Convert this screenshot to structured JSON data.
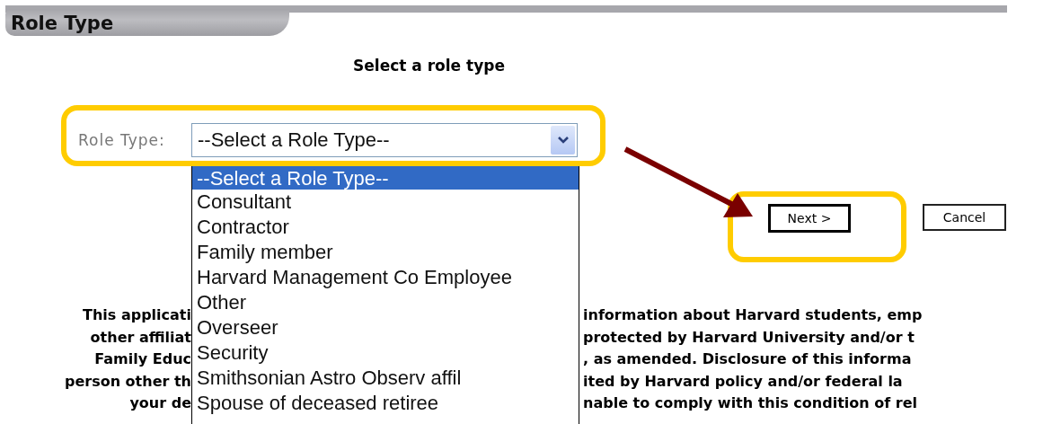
{
  "header": {
    "title": "Role Type"
  },
  "heading": "Select a role type",
  "role_field": {
    "label": "Role Type:",
    "value": "--Select a Role Type--",
    "expanded": true,
    "highlighted": true,
    "options": [
      {
        "label": "--Select a Role Type--",
        "selected": true
      },
      {
        "label": "Consultant",
        "selected": false
      },
      {
        "label": "Contractor",
        "selected": false
      },
      {
        "label": "Family member",
        "selected": false
      },
      {
        "label": "Harvard Management Co Employee",
        "selected": false
      },
      {
        "label": "Other",
        "selected": false
      },
      {
        "label": "Overseer",
        "selected": false
      },
      {
        "label": "Security",
        "selected": false
      },
      {
        "label": "Smithsonian Astro Observ affil",
        "selected": false
      },
      {
        "label": "Spouse of deceased retiree",
        "selected": false
      }
    ]
  },
  "buttons": [
    {
      "label": "Next >",
      "highlighted": true
    },
    {
      "label": "Cancel",
      "highlighted": false
    }
  ],
  "notice": {
    "lines": [
      {
        "left": "This applicati",
        "right": "information about Harvard students, emp"
      },
      {
        "left": "other affiliat",
        "right": "protected by Harvard University and/or t"
      },
      {
        "left": "Family Educ",
        "right": ", as amended. Disclosure of this informa"
      },
      {
        "left": "person other th",
        "right": "ited by Harvard policy and/or federal la"
      },
      {
        "left": "your de",
        "right": "nable to comply with this condition of rel"
      }
    ]
  }
}
